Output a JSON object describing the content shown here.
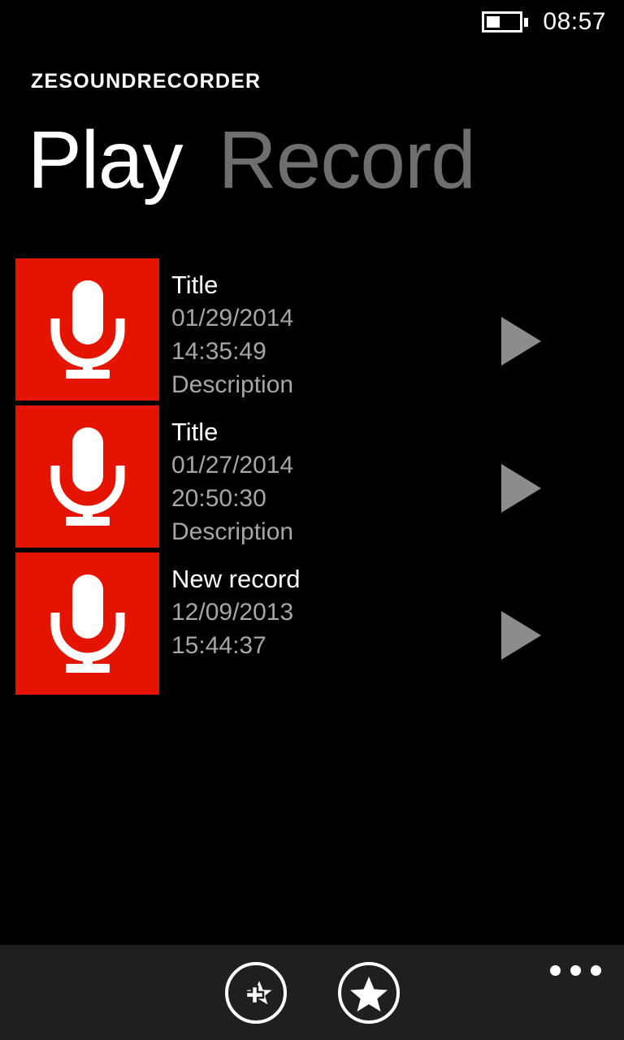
{
  "status_bar": {
    "battery_icon": "battery-icon",
    "battery_level_percent": 40,
    "time": "08:57"
  },
  "app": {
    "title": "ZESOUNDRECORDER",
    "accent_color": "#e51400",
    "background_color": "#000000",
    "appbar_color": "#1f1f1f"
  },
  "pivot": {
    "tabs": [
      {
        "label": "Play",
        "active": true
      },
      {
        "label": "Record",
        "active": false
      }
    ]
  },
  "recordings": [
    {
      "icon": "microphone-icon",
      "title": "Title",
      "date": "01/29/2014",
      "time": "14:35:49",
      "description": "Description",
      "play_icon": "play-icon"
    },
    {
      "icon": "microphone-icon",
      "title": "Title",
      "date": "01/27/2014",
      "time": "20:50:30",
      "description": "Description",
      "play_icon": "play-icon"
    },
    {
      "icon": "microphone-icon",
      "title": "New record",
      "date": "12/09/2013",
      "time": "15:44:37",
      "description": "",
      "play_icon": "play-icon"
    }
  ],
  "app_bar": {
    "buttons": [
      {
        "name": "add-favorite-button",
        "icon": "star-plus-icon"
      },
      {
        "name": "favorites-button",
        "icon": "star-icon"
      }
    ],
    "overflow_icon": "more-dots-icon"
  }
}
